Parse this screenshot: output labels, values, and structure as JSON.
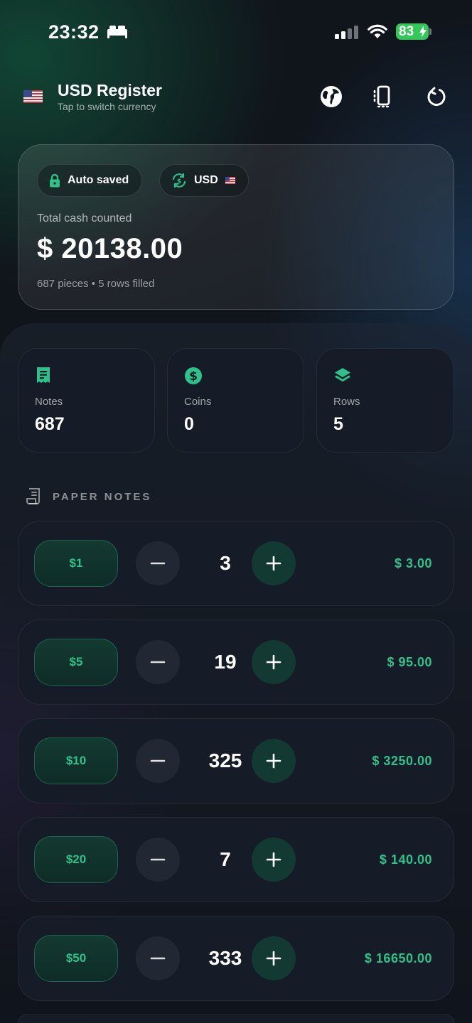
{
  "status": {
    "time": "23:32",
    "battery": "83"
  },
  "header": {
    "title": "USD Register",
    "subtitle": "Tap to switch currency"
  },
  "total_card": {
    "auto_saved": "Auto saved",
    "currency": "USD",
    "label": "Total cash counted",
    "amount": "$ 20138.00",
    "meta": "687 pieces • 5 rows filled"
  },
  "stats": [
    {
      "label": "Notes",
      "value": "687"
    },
    {
      "label": "Coins",
      "value": "0"
    },
    {
      "label": "Rows",
      "value": "5"
    }
  ],
  "section": {
    "title": "PAPER NOTES"
  },
  "rows": [
    {
      "denom": "$1",
      "count": "3",
      "subtotal": "$ 3.00"
    },
    {
      "denom": "$5",
      "count": "19",
      "subtotal": "$ 95.00"
    },
    {
      "denom": "$10",
      "count": "325",
      "subtotal": "$ 3250.00"
    },
    {
      "denom": "$20",
      "count": "7",
      "subtotal": "$ 140.00"
    },
    {
      "denom": "$50",
      "count": "333",
      "subtotal": "$ 16650.00"
    }
  ],
  "colors": {
    "accent": "#2ec28a",
    "card": "#151b27",
    "battery": "#34c759"
  }
}
